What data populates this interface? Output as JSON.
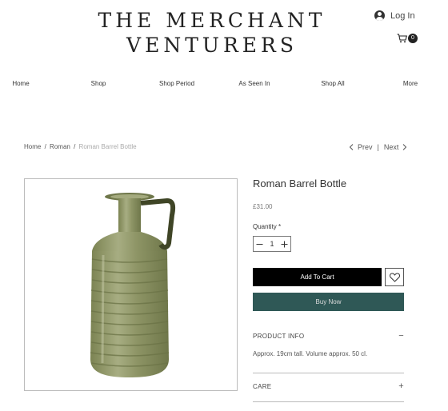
{
  "header": {
    "logo_line1": "THE MERCHANT",
    "logo_line2": "VENTURERS",
    "login_label": "Log In",
    "cart_count": "0"
  },
  "nav": {
    "items": [
      "Home",
      "Shop",
      "Shop Period",
      "As Seen In",
      "Shop All",
      "More"
    ]
  },
  "breadcrumb": {
    "home": "Home",
    "category": "Roman",
    "current": "Roman Barrel Bottle",
    "separator": "/"
  },
  "pager": {
    "prev": "Prev",
    "separator": "|",
    "next": "Next"
  },
  "product": {
    "title": "Roman Barrel Bottle",
    "price": "£31.00",
    "quantity_label": "Quantity *",
    "quantity_value": "1",
    "add_to_cart": "Add To Cart",
    "buy_now": "Buy Now",
    "image_alt": "green glass barrel bottle with handle"
  },
  "sections": {
    "product_info": {
      "title": "PRODUCT INFO",
      "toggle": "−",
      "text": "Approx. 19cm tall. Volume approx. 50 cl."
    },
    "care": {
      "title": "CARE",
      "toggle": "+"
    }
  },
  "colors": {
    "buy_now_bg": "#2f5856",
    "add_to_cart_bg": "#000000",
    "glass": "#8a9160"
  }
}
